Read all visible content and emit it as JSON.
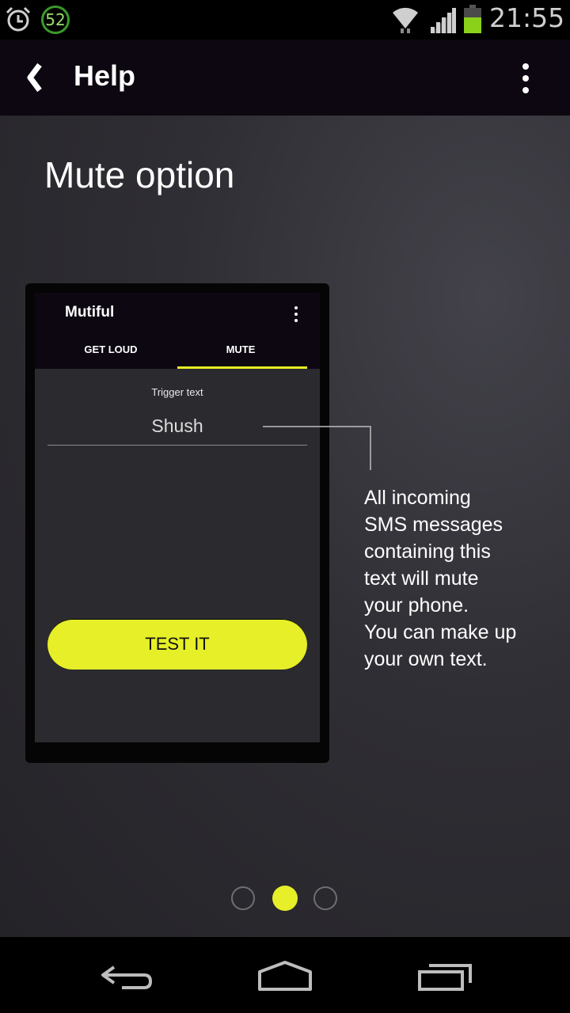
{
  "status_bar": {
    "notification_count": "52",
    "time": "21:55",
    "icons": [
      "alarm-icon",
      "notification-badge",
      "wifi-icon",
      "signal-icon",
      "battery-icon"
    ],
    "battery_color": "#8bd11a"
  },
  "action_bar": {
    "title": "Help",
    "back_icon": "back-chevron-icon",
    "menu_icon": "overflow-menu-icon"
  },
  "page": {
    "title": "Mute option",
    "description_lines": [
      "All incoming",
      "SMS messages",
      "containing this",
      "text will mute",
      "your phone.",
      "You can make up",
      "your own text."
    ]
  },
  "mockup": {
    "app_title": "Mutiful",
    "tabs": [
      {
        "label": "GET LOUD",
        "selected": false
      },
      {
        "label": "MUTE",
        "selected": true
      }
    ],
    "field_label": "Trigger text",
    "field_value": "Shush",
    "button_label": "TEST IT"
  },
  "pager": {
    "page_count": 3,
    "current_page": 2
  },
  "colors": {
    "accent": "#e6ef27",
    "action_bar": "#0c0710",
    "background": "#2f2e34"
  },
  "nav_bar": {
    "buttons": [
      "back-icon",
      "home-icon",
      "recent-apps-icon"
    ]
  }
}
